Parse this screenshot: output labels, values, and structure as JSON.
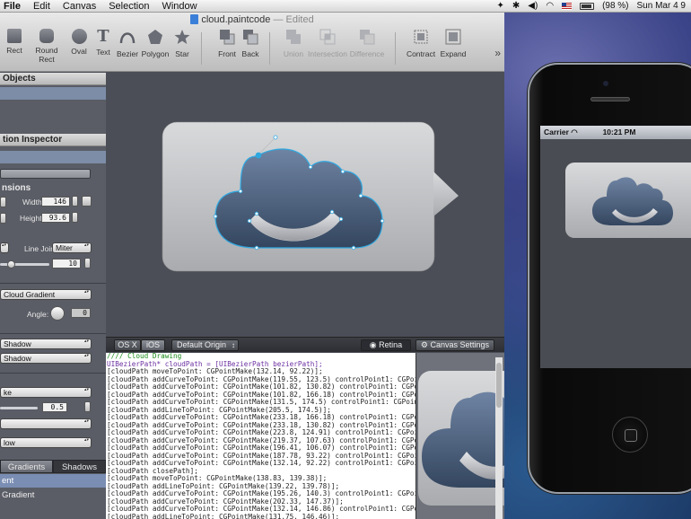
{
  "menubar": {
    "app": "File",
    "items": [
      "Edit",
      "Canvas",
      "Selection",
      "Window"
    ],
    "status": {
      "battery": "(98 %)",
      "clock": "Sun Mar 4 9"
    }
  },
  "window": {
    "title": "cloud.paintcode",
    "edited": "— Edited",
    "tools": {
      "rect": "Rect",
      "round_rect": "Round Rect",
      "oval": "Oval",
      "text": "Text",
      "bezier": "Bezier",
      "polygon": "Polygon",
      "star": "Star",
      "front": "Front",
      "back": "Back",
      "union": "Union",
      "intersection": "Intersection",
      "difference": "Difference",
      "contract": "Contract",
      "expand": "Expand"
    }
  },
  "sidebar": {
    "objects_header": "Objects",
    "inspector_header": "tion Inspector",
    "dimensions_label": "nsions",
    "width_label": "Width:",
    "width_value": "146",
    "height_label": "Height:",
    "height_value": "93.6",
    "line_join_label": "Line Join:",
    "line_join_value": "Miter",
    "stroke_value": "10",
    "gradient_popup": "Cloud Gradient",
    "angle_label": "Angle:",
    "angle_value": "0",
    "shadow_popup_1": "Shadow",
    "shadow_popup_2": "Shadow",
    "popup_ke": "ke",
    "opacity_value": "0.5",
    "popup_low": "low",
    "tabs": {
      "gradients": "Gradients",
      "shadows": "Shadows"
    },
    "list": {
      "selected": "ent",
      "item": "Gradient"
    }
  },
  "codebar": {
    "osx": "OS X",
    "ios": "iOS",
    "origin": "Default Origin",
    "retina": "Retina",
    "canvas_settings": "Canvas Settings"
  },
  "code": {
    "lines": [
      "//// Cloud Drawing",
      "UIBezierPath* cloudPath = [UIBezierPath bezierPath];",
      "[cloudPath moveToPoint: CGPointMake(132.14, 92.22)];",
      "[cloudPath addCurveToPoint: CGPointMake(119.55, 123.5) controlPoint1: CGPointM",
      "[cloudPath addCurveToPoint: CGPointMake(101.82, 130.82) controlPoint1: CGPoin",
      "[cloudPath addCurveToPoint: CGPointMake(101.82, 166.18) controlPoint1: CGPoin",
      "[cloudPath addCurveToPoint: CGPointMake(131.5, 174.5) controlPoint1: CGPointM",
      "[cloudPath addLineToPoint: CGPointMake(205.5, 174.5)];",
      "[cloudPath addCurveToPoint: CGPointMake(233.18, 166.18) controlPoint1: CGPoin",
      "[cloudPath addCurveToPoint: CGPointMake(233.18, 130.82) controlPoint1: CGPoin",
      "[cloudPath addCurveToPoint: CGPointMake(223.8, 124.91) controlPoint1: CGPoint",
      "[cloudPath addCurveToPoint: CGPointMake(219.37, 107.63) controlPoint1: CGPoin",
      "[cloudPath addCurveToPoint: CGPointMake(196.41, 106.07) controlPoint1: CGPoin",
      "[cloudPath addCurveToPoint: CGPointMake(187.78, 93.22) controlPoint1: CGPoint",
      "[cloudPath addCurveToPoint: CGPointMake(132.14, 92.22) controlPoint1: CGPoint",
      "[cloudPath closePath];",
      "[cloudPath moveToPoint: CGPointMake(138.83, 139.38)];",
      "[cloudPath addLineToPoint: CGPointMake(139.22, 139.78)];",
      "[cloudPath addCurveToPoint: CGPointMake(195.26, 140.3) controlPoint1: CGPointM",
      "[cloudPath addCurveToPoint: CGPointMake(202.33, 147.37)];",
      "[cloudPath addCurveToPoint: CGPointMake(132.14, 146.86) controlPoint1: CGPoint",
      "[cloudPath addLineToPoint: CGPointMake(131.75, 146.46)];"
    ]
  },
  "phone": {
    "carrier": "Carrier",
    "time": "10:21 PM"
  }
}
